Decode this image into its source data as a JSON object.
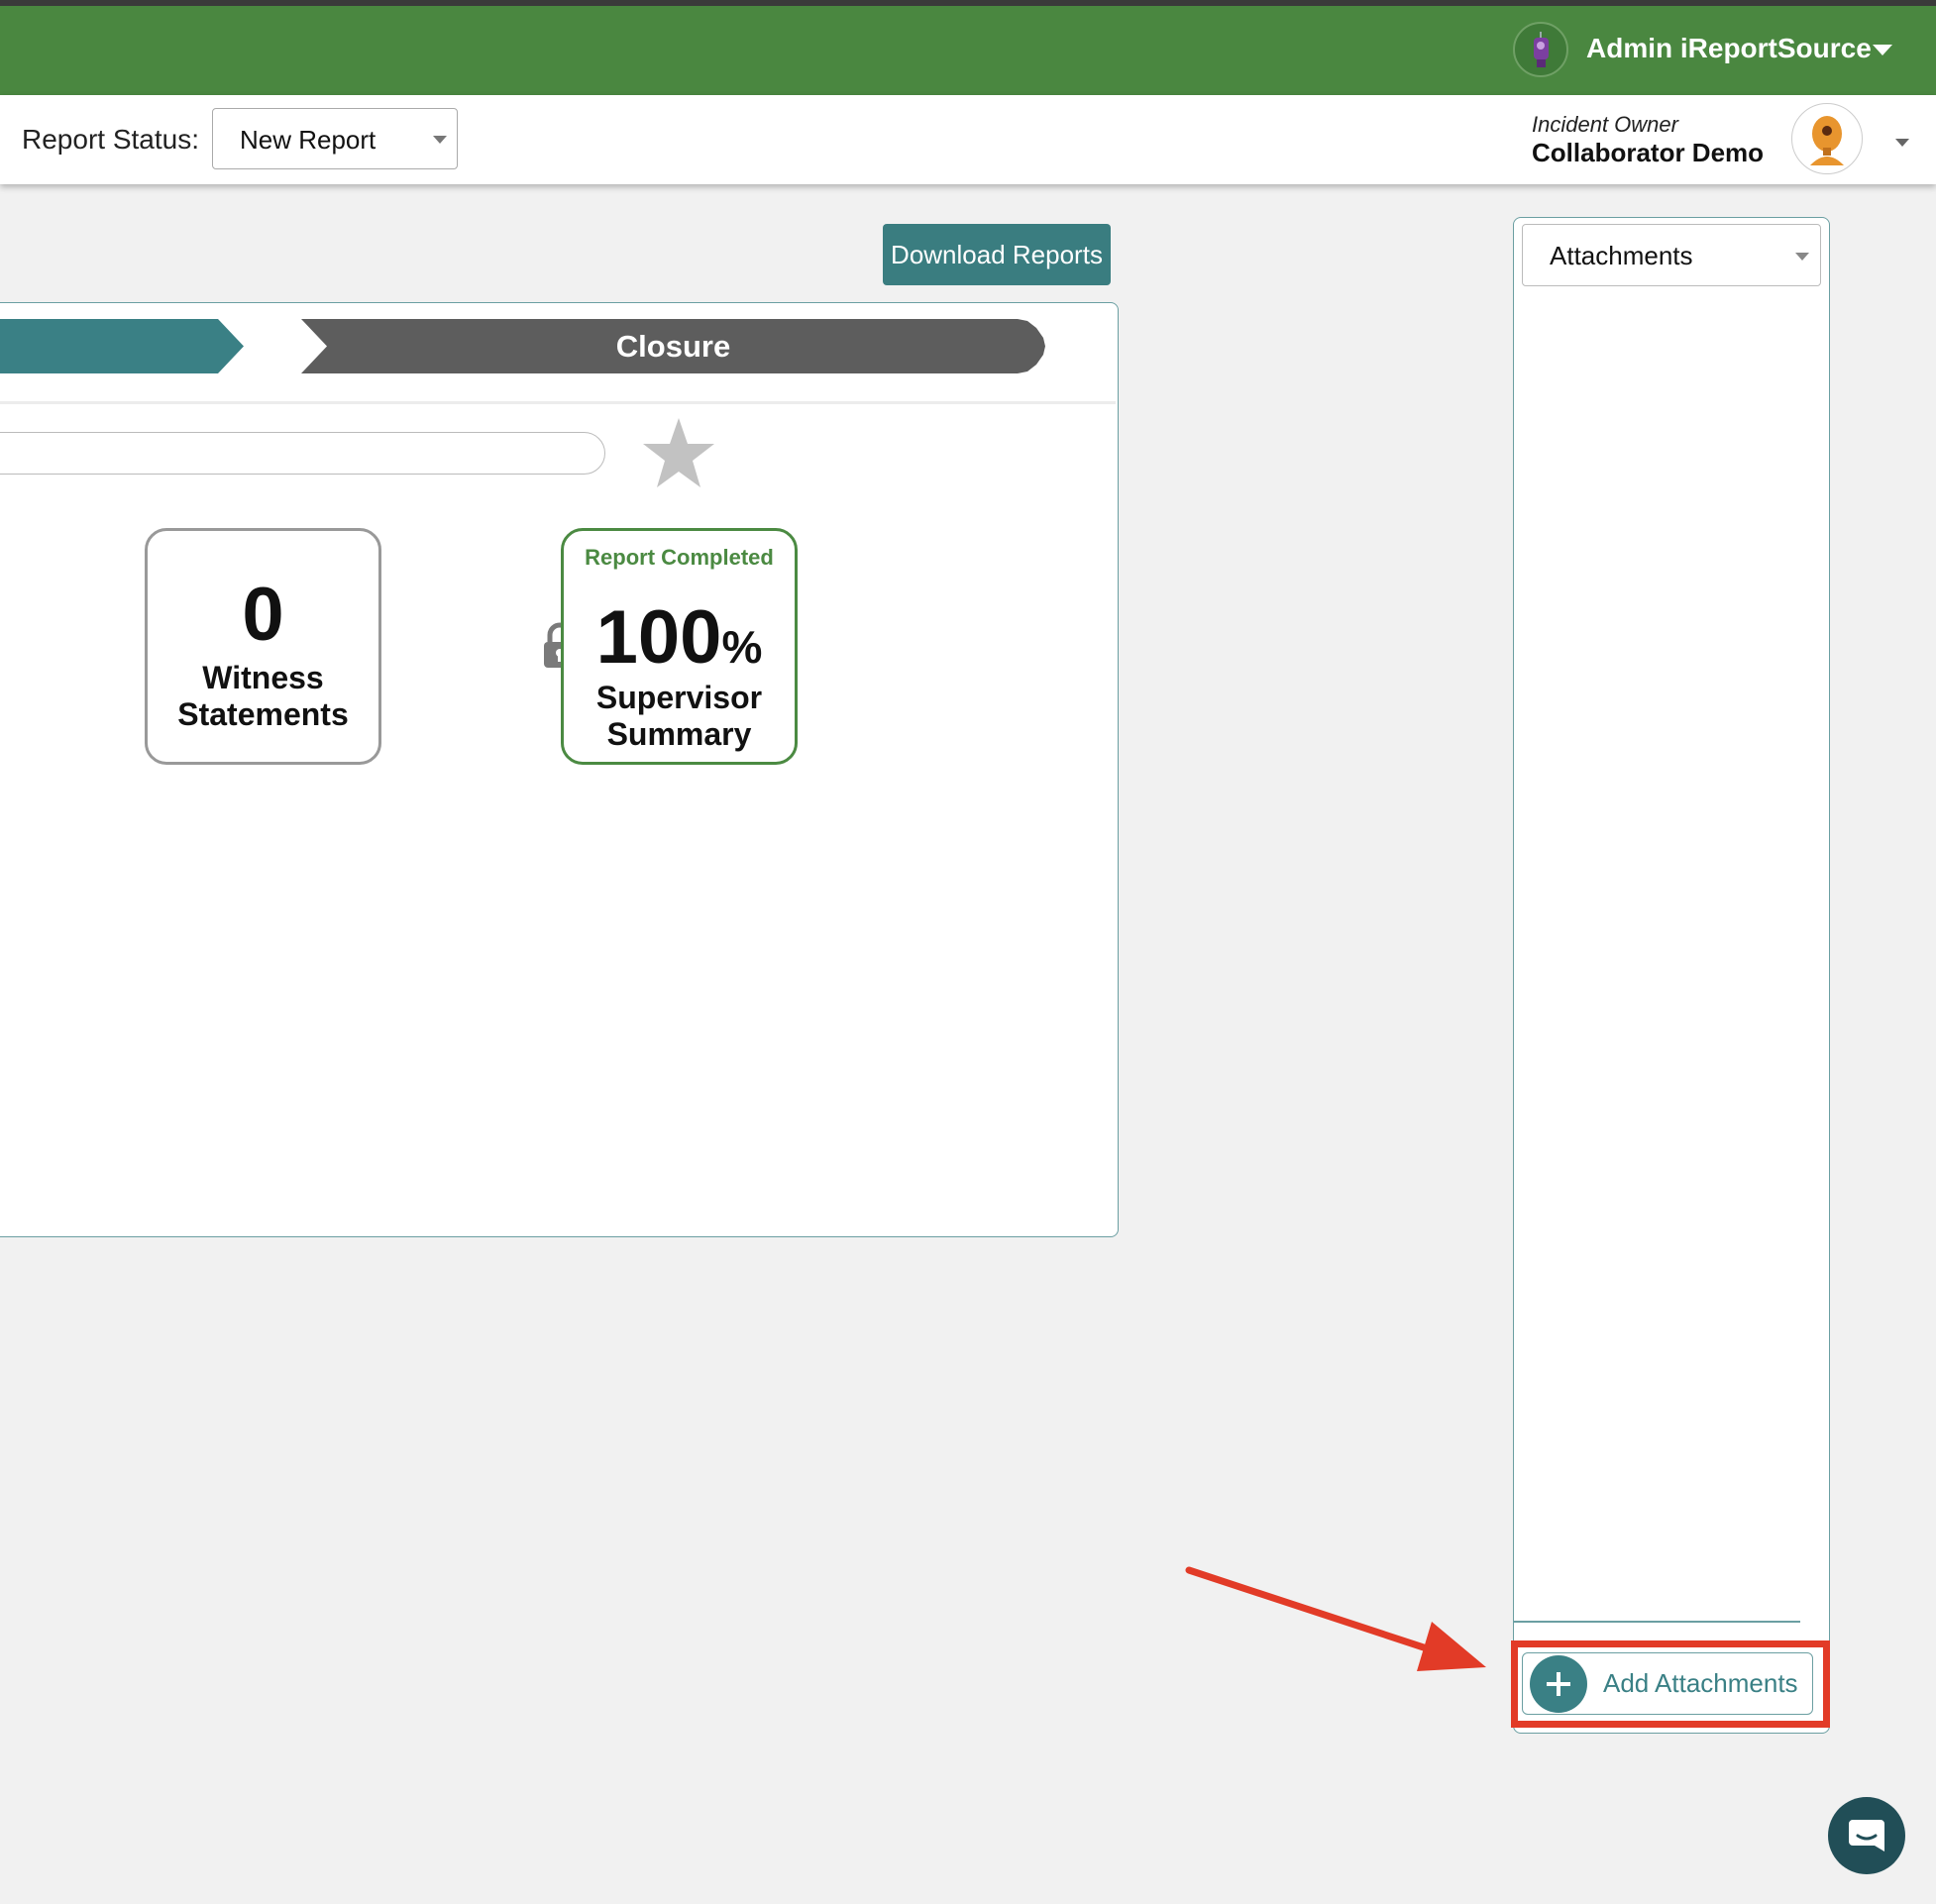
{
  "header": {
    "user_name": "Admin iReportSource",
    "brand_color": "#4a8740"
  },
  "subheader": {
    "report_status_label": "Report Status:",
    "report_status_value": "New Report",
    "owner_label": "Incident Owner",
    "owner_name": "Collaborator Demo"
  },
  "toolbar": {
    "download_label": "Download Reports"
  },
  "progress_steps": {
    "closure_label": "Closure",
    "active_color": "#3a8085",
    "inactive_color": "#5d5d5d"
  },
  "cards": {
    "witness": {
      "count": "0",
      "label": "Witness Statements"
    },
    "summary": {
      "status": "Report Completed",
      "percent": "100",
      "percent_sign": "%",
      "label": "Supervisor Summary"
    }
  },
  "sidebar": {
    "select_label": "Attachments",
    "add_label": "Add Attachments"
  },
  "icons": {
    "star": "star-icon",
    "lock": "lock-icon",
    "add": "plus-icon",
    "chat": "chat-icon"
  },
  "annotation_color": "#e23b27"
}
